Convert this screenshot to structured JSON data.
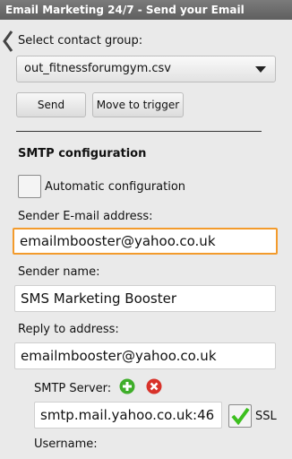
{
  "app": {
    "title": "Email Marketing 24/7 - Send your Email"
  },
  "contact_group": {
    "label": "Select contact group:",
    "selected": "out_fitnessforumgym.csv"
  },
  "buttons": {
    "send": "Send",
    "move_to_trigger": "Move to trigger"
  },
  "smtp": {
    "heading": "SMTP configuration",
    "auto_config_label": "Automatic configuration",
    "auto_config_checked": false,
    "sender_email_label": "Sender E-mail address:",
    "sender_email_value": "emailmbooster@yahoo.co.uk",
    "sender_name_label": "Sender name:",
    "sender_name_value": "SMS Marketing Booster",
    "reply_to_label": "Reply to address:",
    "reply_to_value": "emailmbooster@yahoo.co.uk",
    "server_label": "SMTP Server:",
    "server_value": "smtp.mail.yahoo.co.uk:46",
    "ssl_label": "SSL",
    "ssl_checked": true,
    "username_label": "Username:"
  },
  "icons": {
    "back": "chevron-left-icon",
    "add": "add-icon",
    "remove": "remove-icon",
    "check": "checkmark-icon"
  },
  "colors": {
    "focus_border": "#f39b2c",
    "add_green": "#3fae2a",
    "remove_red": "#d8322a",
    "check_green": "#3cbf1e"
  }
}
